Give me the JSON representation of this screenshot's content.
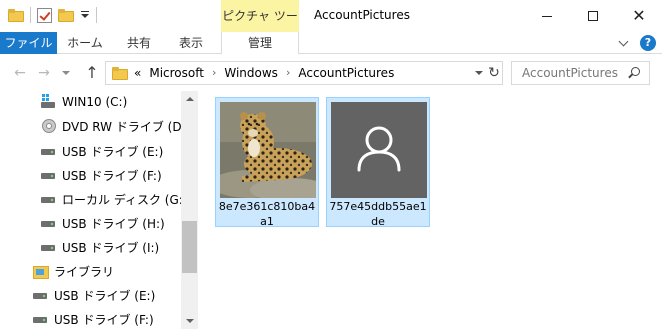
{
  "window": {
    "title": "AccountPictures",
    "context_tab": "ピクチャ ツール",
    "controls": {
      "minimize": "—",
      "maximize": "☐",
      "close": "✕"
    }
  },
  "ribbon": {
    "tabs": [
      "ファイル",
      "ホーム",
      "共有",
      "表示",
      "管理"
    ],
    "help": "?"
  },
  "address": {
    "overflow": "«",
    "crumbs": [
      "Microsoft",
      "Windows",
      "AccountPictures"
    ],
    "separator": "›"
  },
  "search": {
    "placeholder": "AccountPictures"
  },
  "nav_tree": [
    {
      "label": "WIN10 (C:)",
      "icon": "windows-drive-icon"
    },
    {
      "label": "DVD RW ドライブ (D:)",
      "icon": "dvd-drive-icon"
    },
    {
      "label": "USB ドライブ (E:)",
      "icon": "usb-drive-icon"
    },
    {
      "label": "USB ドライブ (F:)",
      "icon": "usb-drive-icon"
    },
    {
      "label": "ローカル ディスク (G:)",
      "icon": "local-disk-icon"
    },
    {
      "label": "USB ドライブ (H:)",
      "icon": "usb-drive-icon"
    },
    {
      "label": "USB ドライブ (I:)",
      "icon": "usb-drive-icon"
    },
    {
      "label": "ライブラリ",
      "icon": "library-icon"
    },
    {
      "label": "USB ドライブ (E:)",
      "icon": "usb-drive-icon"
    },
    {
      "label": "USB ドライブ (F:)",
      "icon": "usb-drive-icon"
    }
  ],
  "files": [
    {
      "name": "8e7e361c810ba4a1",
      "thumbnail": "leopard-photo"
    },
    {
      "name": "757e45ddb55ae1de",
      "thumbnail": "default-user-avatar"
    }
  ],
  "colors": {
    "file_tab": "#1979ca",
    "context_tab": "#fbf4a3",
    "selection": "#cce8ff",
    "selection_border": "#99d1ff"
  }
}
